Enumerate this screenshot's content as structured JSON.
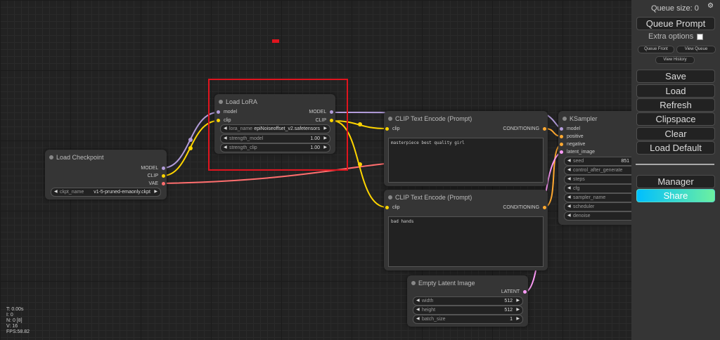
{
  "sidebar": {
    "queue_size": "Queue size: 0",
    "gear": "⚙",
    "queue_prompt": "Queue Prompt",
    "extra_options": "Extra options",
    "queue_front": "Queue Front",
    "view_queue": "View Queue",
    "view_history": "View History",
    "save": "Save",
    "load": "Load",
    "refresh": "Refresh",
    "clipspace": "Clipspace",
    "clear": "Clear",
    "load_default": "Load Default",
    "manager": "Manager",
    "share": "Share"
  },
  "colors": {
    "model": "#b39ddb",
    "clip": "#ffd500",
    "vae": "#ff6e6e",
    "conditioning": "#ffa931",
    "latent": "#ff9cf9",
    "highlight": "#e0141e"
  },
  "nodes": {
    "checkpoint": {
      "title": "Load Checkpoint",
      "out_model": "MODEL",
      "out_clip": "CLIP",
      "out_vae": "VAE",
      "ckpt_label": "ckpt_name",
      "ckpt_value": "v1-5-pruned-emaonly.ckpt"
    },
    "lora": {
      "title": "Load LoRA",
      "in_model": "model",
      "in_clip": "clip",
      "out_model": "MODEL",
      "out_clip": "CLIP",
      "lora_label": "lora_name",
      "lora_value": "epiNoiseoffset_v2.safetensors",
      "sm_label": "strength_model",
      "sm_value": "1.00",
      "sc_label": "strength_clip",
      "sc_value": "1.00"
    },
    "clip_pos": {
      "title": "CLIP Text Encode (Prompt)",
      "in_clip": "clip",
      "out": "CONDITIONING",
      "text": "masterpiece best quality girl"
    },
    "clip_neg": {
      "title": "CLIP Text Encode (Prompt)",
      "in_clip": "clip",
      "out": "CONDITIONING",
      "text": "bad hands"
    },
    "latent": {
      "title": "Empty Latent Image",
      "out": "LATENT",
      "w_label": "width",
      "w_value": "512",
      "h_label": "height",
      "h_value": "512",
      "b_label": "batch_size",
      "b_value": "1"
    },
    "ksampler": {
      "title": "KSampler",
      "in_model": "model",
      "in_positive": "positive",
      "in_negative": "negative",
      "in_latent": "latent_image",
      "seed_label": "seed",
      "seed_value": "851",
      "w2": "control_after_generate",
      "w3": "steps",
      "w4": "cfg",
      "w5": "sampler_name",
      "w6": "scheduler",
      "w7": "denoise"
    }
  },
  "stats": {
    "t": "T: 0.00s",
    "i": "I: 0",
    "n": "N: 0 [8]",
    "v": "V: 16",
    "fps": "FPS:58.82"
  }
}
